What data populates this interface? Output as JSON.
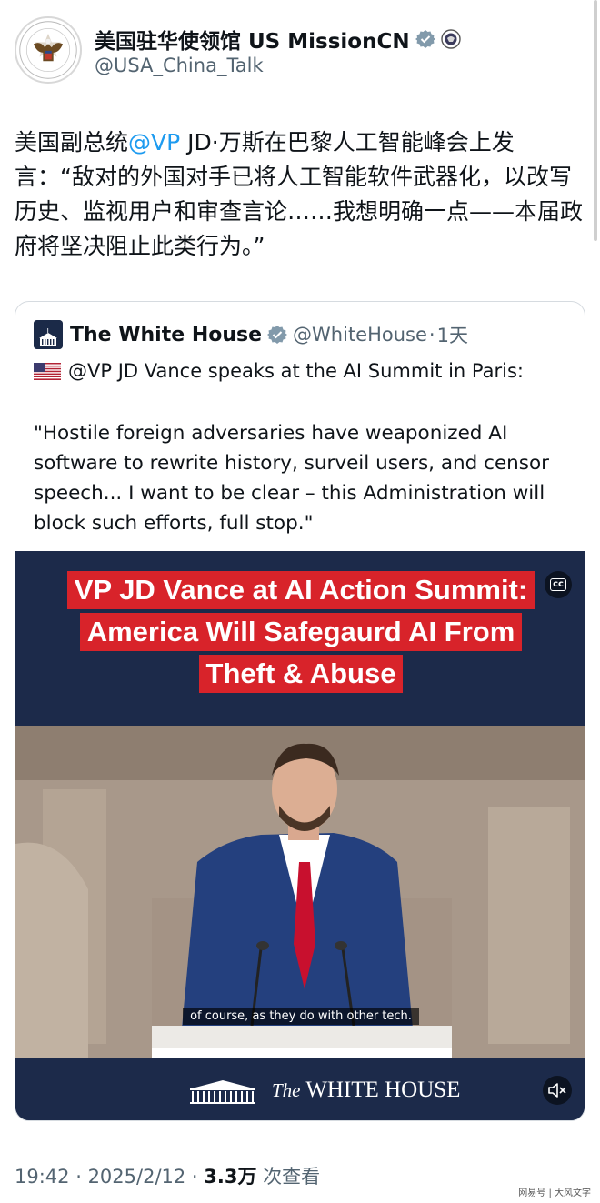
{
  "post": {
    "author_name": "美国驻华使领馆 US MissionCN",
    "author_handle": "@USA_China_Talk",
    "text_prefix": "美国副总统",
    "mention": "@VP",
    "text_body": " JD·万斯在巴黎人工智能峰会上发言：“敌对的外国对手已将人工智能软件武器化，以改写历史、监视用户和审查言论……我想明确一点——本届政府将坚决阻止此类行为。”"
  },
  "quoted_post": {
    "author_name": "The White House",
    "author_handle": "@WhiteHouse",
    "separator": "·",
    "time_ago": "1天",
    "headline": "@VP JD Vance speaks at the AI Summit in Paris:",
    "quote_text": "\"Hostile foreign adversaries have weaponized AI software to rewrite history, surveil users, and censor speech... I want to be clear – this Administration will block such efforts, full stop.\""
  },
  "video": {
    "title_lines": [
      "VP JD Vance at AI Action Summit:",
      "America Will Safegaurd AI From",
      "Theft & Abuse"
    ],
    "cc_label": "cc",
    "subtitle": "of course, as they do with other tech.",
    "footer_the": "The",
    "footer_brand": "WHITE HOUSE",
    "mute_icon": "speaker-muted-icon"
  },
  "meta": {
    "time": "19:42",
    "dot": " · ",
    "date": "2025/2/12",
    "views_count": "3.3万",
    "views_label": " 次查看"
  },
  "watermark": "网易号 | 大风文字",
  "colors": {
    "mention_blue": "#1d9bf0",
    "title_red": "#d8232a",
    "video_navy": "#1c2a4a",
    "secondary_text": "#536471"
  }
}
